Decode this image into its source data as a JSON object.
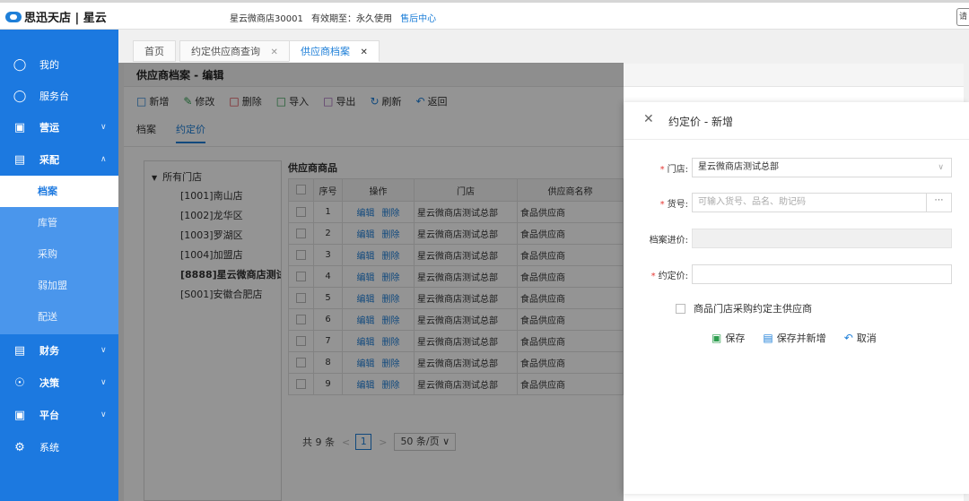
{
  "topbar": {
    "brand": "思迅天店 | 星云",
    "store": "星云微商店30001",
    "validity": "有效期至：永久使用",
    "support_link": "售后中心",
    "right_btn": "请"
  },
  "sidebar": {
    "items": [
      {
        "label": "我的",
        "icon": "user-icon"
      },
      {
        "label": "服务台",
        "icon": "user-icon"
      },
      {
        "label": "营运",
        "icon": "chart-icon"
      },
      {
        "label": "采配",
        "icon": "cart-icon"
      },
      {
        "label": "财务",
        "icon": "ledger-icon"
      },
      {
        "label": "决策",
        "icon": "bulb-icon"
      },
      {
        "label": "平台",
        "icon": "platform-icon"
      },
      {
        "label": "系统",
        "icon": "gear-icon"
      }
    ],
    "subitems": [
      "档案",
      "库管",
      "采购",
      "弱加盟",
      "配送"
    ]
  },
  "tabs": [
    {
      "label": "首页",
      "closable": false
    },
    {
      "label": "约定供应商查询",
      "closable": true
    },
    {
      "label": "供应商档案",
      "closable": true,
      "active": true
    }
  ],
  "page": {
    "title": "供应商档案 - 编辑",
    "toolbar": {
      "add": "新增",
      "edit": "修改",
      "delete": "删除",
      "import": "导入",
      "export": "导出",
      "refresh": "刷新",
      "back": "返回"
    },
    "subtabs": [
      "档案",
      "约定价"
    ],
    "tree": {
      "root": "所有门店",
      "nodes": [
        "[1001]南山店",
        "[1002]龙华区",
        "[1003]罗湖区",
        "[1004]加盟店",
        "[8888]星云微商店测试总",
        "[S001]安徽合肥店"
      ]
    },
    "grid": {
      "title": "供应商商品",
      "headers": [
        "序号",
        "操作",
        "门店",
        "供应商名称"
      ],
      "edit_label": "编辑",
      "delete_label": "删除",
      "rows": [
        {
          "no": "1",
          "store": "星云微商店测试总部",
          "supplier": "食品供应商"
        },
        {
          "no": "2",
          "store": "星云微商店测试总部",
          "supplier": "食品供应商"
        },
        {
          "no": "3",
          "store": "星云微商店测试总部",
          "supplier": "食品供应商"
        },
        {
          "no": "4",
          "store": "星云微商店测试总部",
          "supplier": "食品供应商"
        },
        {
          "no": "5",
          "store": "星云微商店测试总部",
          "supplier": "食品供应商"
        },
        {
          "no": "6",
          "store": "星云微商店测试总部",
          "supplier": "食品供应商"
        },
        {
          "no": "7",
          "store": "星云微商店测试总部",
          "supplier": "食品供应商"
        },
        {
          "no": "8",
          "store": "星云微商店测试总部",
          "supplier": "食品供应商"
        },
        {
          "no": "9",
          "store": "星云微商店测试总部",
          "supplier": "食品供应商"
        }
      ]
    },
    "pager": {
      "total": "共 9 条",
      "prev": "<",
      "current": "1",
      "next": ">",
      "size": "50 条/页"
    }
  },
  "drawer": {
    "title": "约定价 - 新增",
    "store_label": "门店:",
    "store_value": "星云微商店测试总部",
    "sku_label": "货号:",
    "sku_placeholder": "可输入货号、品名、助记码",
    "cost_label": "档案进价:",
    "price_label": "约定价:",
    "checkbox_label": "商品门店采购约定主供应商",
    "save": "保存",
    "save_new": "保存并新增",
    "cancel": "取消"
  },
  "colors": {
    "sidebar": "#1c79e0",
    "accent": "#1e7fd8",
    "required": "#e53935"
  }
}
